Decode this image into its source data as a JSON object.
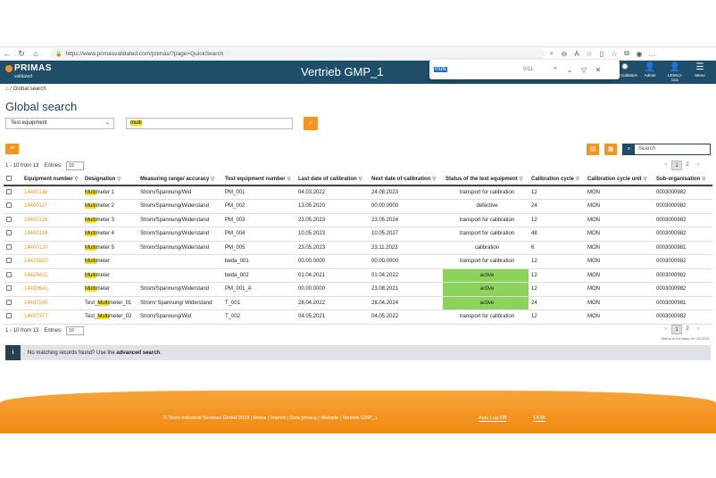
{
  "browser": {
    "url": "https://www.primasvalidated.com/primas/?page=QuickSearch",
    "nav": [
      "←",
      "↻",
      "⌂"
    ],
    "icons": [
      "find-icon",
      "zoom-icon",
      "read-aloud-icon",
      "favorite-icon",
      "split-icon",
      "favorites-bar-icon",
      "collections-icon",
      "profile-icon",
      "more-icon"
    ]
  },
  "findbar": {
    "query": "multi",
    "count": "0/11"
  },
  "app": {
    "logo_text": "PRIMAS",
    "logo_sub": "validated",
    "title": "Vertrieb GMP_1",
    "top_icons": [
      {
        "name": "accreditation",
        "label": "Accreditation",
        "glyph": "✹"
      },
      {
        "name": "admin",
        "label": "Admin",
        "glyph": "👤"
      },
      {
        "name": "user",
        "label": "1200tcz-bca",
        "glyph": "👤"
      },
      {
        "name": "menu",
        "label": "Menu",
        "glyph": "☰"
      }
    ]
  },
  "breadcrumb": {
    "home": "⌂",
    "sep": "/",
    "current": "Global search"
  },
  "page_title": "Global search",
  "filter": {
    "category": "Test equipment",
    "search_value_highlight": "multi"
  },
  "table_search_placeholder": "Search",
  "info_top": "1 - 10 from 13",
  "info_bottom": "1 - 10 from 13",
  "entries_label": "Entries:",
  "entries_value": "10",
  "pager": {
    "prev": "‹",
    "next": "›",
    "pages": [
      "1",
      "2"
    ]
  },
  "stamp": "Status of the data: 09.10.2023",
  "columns": [
    "Equipment number",
    "Designation",
    "Measuring range/ accuracy",
    "Test equipment number",
    "Last date of calibration",
    "Next date of calibration",
    "Status of the test equipment",
    "Calibration cycle",
    "Calibration cycle unit",
    "Sub-organisation"
  ],
  "rows": [
    {
      "eq": "14400116",
      "des_pre": "",
      "des_hl": "Multi",
      "des_post": "meter 1",
      "range": "Strom/Spannung/Wid",
      "ten": "PM_001",
      "last": "04.03.2022",
      "next": "24.08.2023",
      "status": "transport for calibration",
      "active": false,
      "cycle": "12",
      "unit": "MON",
      "sub": "0003000982"
    },
    {
      "eq": "14400117",
      "des_pre": "",
      "des_hl": "Multi",
      "des_post": "meter 2",
      "range": "Strom/Spannung/Widerstand",
      "ten": "PM_002",
      "last": "13.05.2020",
      "next": "00.00.0000",
      "status": "defective",
      "active": false,
      "cycle": "24",
      "unit": "MON",
      "sub": "0003000982"
    },
    {
      "eq": "14400118",
      "des_pre": "",
      "des_hl": "Multi",
      "des_post": "meter 3",
      "range": "Strom/Spannung/Widerstand",
      "ten": "PM_003",
      "last": "23.05.2023",
      "next": "23.05.2024",
      "status": "transport for calibration",
      "active": false,
      "cycle": "12",
      "unit": "MON",
      "sub": "0003000982"
    },
    {
      "eq": "14400119",
      "des_pre": "",
      "des_hl": "Multi",
      "des_post": "meter 4",
      "range": "Strom/Spannung/Widerstand",
      "ten": "PM_004",
      "last": "10.05.2023",
      "next": "10.05.2027",
      "status": "transport for calibration",
      "active": false,
      "cycle": "48",
      "unit": "MON",
      "sub": "0003000982"
    },
    {
      "eq": "14400120",
      "des_pre": "",
      "des_hl": "Multi",
      "des_post": "meter 5",
      "range": "Strom/Spannung/Widerstand",
      "ten": "PM_005",
      "last": "23.05.2023",
      "next": "23.11.2023",
      "status": "calibration",
      "active": false,
      "cycle": "6",
      "unit": "MON",
      "sub": "0003000981"
    },
    {
      "eq": "14425920",
      "des_pre": "",
      "des_hl": "Multi",
      "des_post": "meter",
      "range": "",
      "ten": "beda_001",
      "last": "00.00.0000",
      "next": "00.00.0000",
      "status": "transport for calibration",
      "active": false,
      "cycle": "12",
      "unit": "MON",
      "sub": "0003000982"
    },
    {
      "eq": "14426421",
      "des_pre": "",
      "des_hl": "Multi",
      "des_post": "meter",
      "range": "",
      "ten": "beda_002",
      "last": "01.04.2021",
      "next": "01.04.2022",
      "status": "active",
      "active": true,
      "cycle": "12",
      "unit": "MON",
      "sub": "0003000982"
    },
    {
      "eq": "14433641",
      "des_pre": "",
      "des_hl": "Multi",
      "des_post": "meter",
      "range": "Strom/Spannung/Widerstand",
      "ten": "PM_001_A",
      "last": "00.00.0000",
      "next": "23.08.2021",
      "status": "active",
      "active": true,
      "cycle": "12",
      "unit": "MON",
      "sub": "0003000982"
    },
    {
      "eq": "14437245",
      "des_pre": "Test_",
      "des_hl": "Multi",
      "des_post": "meter_01",
      "range": "Strom/ Spannung/ Widerstand",
      "ten": "T_001",
      "last": "28.04.2022",
      "next": "28.04.2024",
      "status": "active",
      "active": true,
      "cycle": "24",
      "unit": "MON",
      "sub": "0003000981"
    },
    {
      "eq": "14437377",
      "des_pre": "Test_",
      "des_hl": "Multi",
      "des_post": "meter_02",
      "range": "Strom/Spannung/Wid",
      "ten": "T_002",
      "last": "04.05.2021",
      "next": "04.05.2022",
      "status": "transport for calibration",
      "active": false,
      "cycle": "12",
      "unit": "MON",
      "sub": "0003000982"
    }
  ],
  "nomatch": {
    "text": "No matching records found? Use the ",
    "link": "advanced search",
    "end": "."
  },
  "footer": {
    "text": "© Testo Industrial Services GmbH 2023 | Home | Imprint | Data privacy | Website | Vertrieb GMP_1",
    "autolog_label": "Auto Log-Off",
    "autolog_time": "14:46"
  }
}
